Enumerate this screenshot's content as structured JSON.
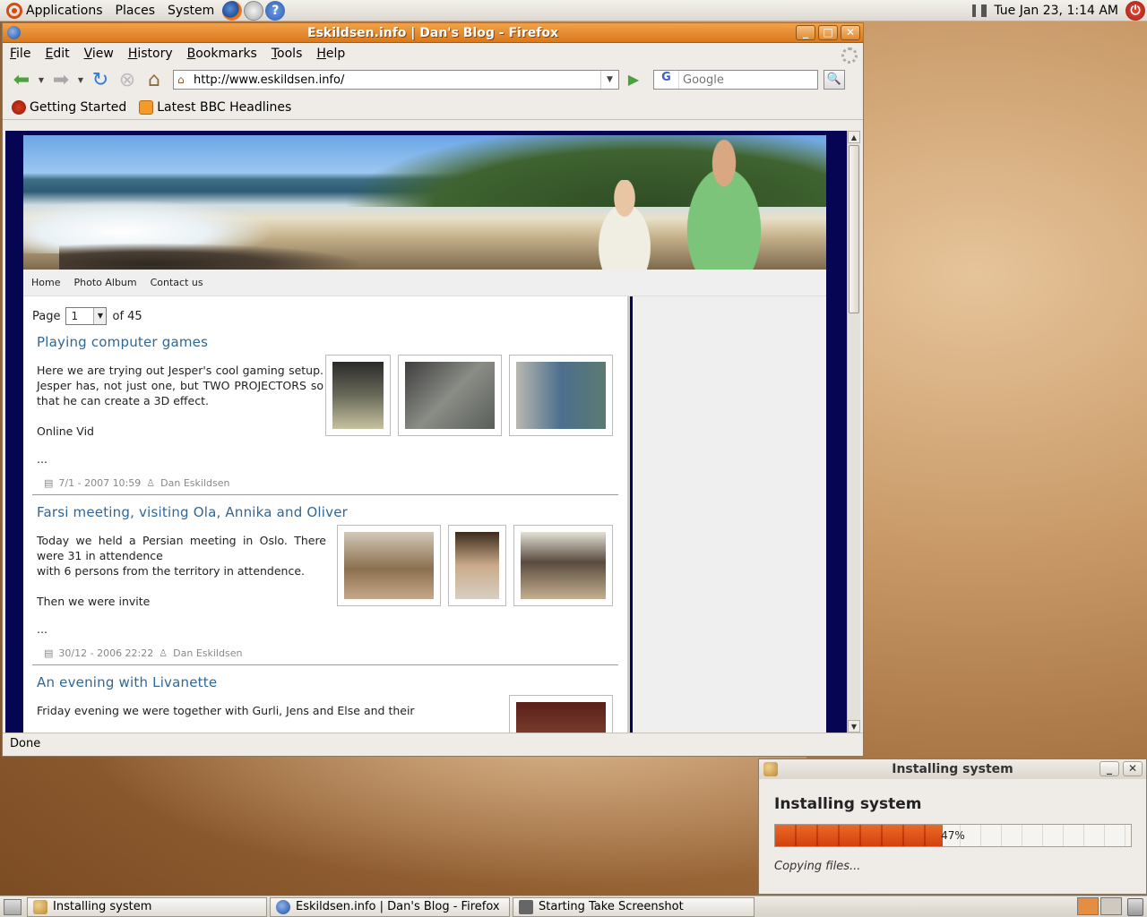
{
  "top_panel": {
    "menus": [
      "Applications",
      "Places",
      "System"
    ],
    "clock": "Tue Jan 23,  1:14 AM"
  },
  "firefox": {
    "title": "Eskildsen.info | Dan's Blog - Firefox",
    "menu": [
      "File",
      "Edit",
      "View",
      "History",
      "Bookmarks",
      "Tools",
      "Help"
    ],
    "url": "http://www.eskildsen.info/",
    "search_placeholder": "Google",
    "search_engine_glyph": "G",
    "bookmarks": [
      "Getting Started",
      "Latest BBC Headlines"
    ],
    "status": "Done"
  },
  "page": {
    "nav": [
      "Home",
      "Photo Album",
      "Contact us"
    ],
    "pager": {
      "label": "Page",
      "current": "1",
      "of": "of 45"
    },
    "posts": [
      {
        "title": "Playing computer games",
        "body": "Here we are trying out Jesper's cool gaming setup. Jesper has, not just one, but TWO PROJECTORS so that he can create a 3D effect.",
        "body2": "Online Vid",
        "ellipsis": "...",
        "date": "7/1 - 2007 10:59",
        "author": "Dan Eskildsen"
      },
      {
        "title": "Farsi meeting, visiting Ola, Annika and Oliver",
        "body": "Today we held a Persian meeting in Oslo. There were 31 in attendence",
        "body_line2": "with 6 persons from the territory in attendence.",
        "body2": "Then we were invite",
        "ellipsis": "...",
        "date": "30/12 - 2006 22:22",
        "author": "Dan Eskildsen"
      },
      {
        "title": "An evening with Livanette",
        "body": "Friday evening we were together with Gurli, Jens and Else and their"
      }
    ]
  },
  "installer": {
    "window_title": "Installing system",
    "heading": "Installing system",
    "progress_text": "47%",
    "progress": 0.47,
    "status": "Copying files..."
  },
  "taskbar": {
    "tasks": [
      "Installing system",
      "Eskildsen.info | Dan's Blog - Firefox",
      "Starting Take Screenshot"
    ]
  }
}
